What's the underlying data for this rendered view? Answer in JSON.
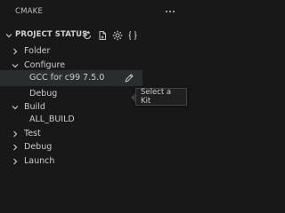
{
  "panel": {
    "title": "CMAKE",
    "more_icon": "ellipsis-icon"
  },
  "section": {
    "label": "PROJECT STATUS",
    "expanded": true,
    "toolbar": [
      {
        "icon": "refresh-icon"
      },
      {
        "icon": "new-file-icon"
      },
      {
        "icon": "gear-icon"
      },
      {
        "icon": "braces-icon"
      }
    ]
  },
  "tree": {
    "folder": {
      "label": "Folder",
      "expanded": false
    },
    "configure": {
      "label": "Configure",
      "expanded": true,
      "kit": {
        "label": "GCC for c99 7.5.0",
        "action_icon": "pencil-icon"
      },
      "variant": {
        "label": "Debug"
      }
    },
    "build": {
      "label": "Build",
      "expanded": true,
      "target": {
        "label": "ALL_BUILD"
      }
    },
    "test": {
      "label": "Test",
      "expanded": false
    },
    "debug": {
      "label": "Debug",
      "expanded": false
    },
    "launch": {
      "label": "Launch",
      "expanded": false
    }
  },
  "tooltip": {
    "text": "Select a Kit"
  },
  "colors": {
    "background": "#181818",
    "text": "#cccccc",
    "hover_row": "#2a2d2e",
    "tooltip_border": "#454545"
  }
}
